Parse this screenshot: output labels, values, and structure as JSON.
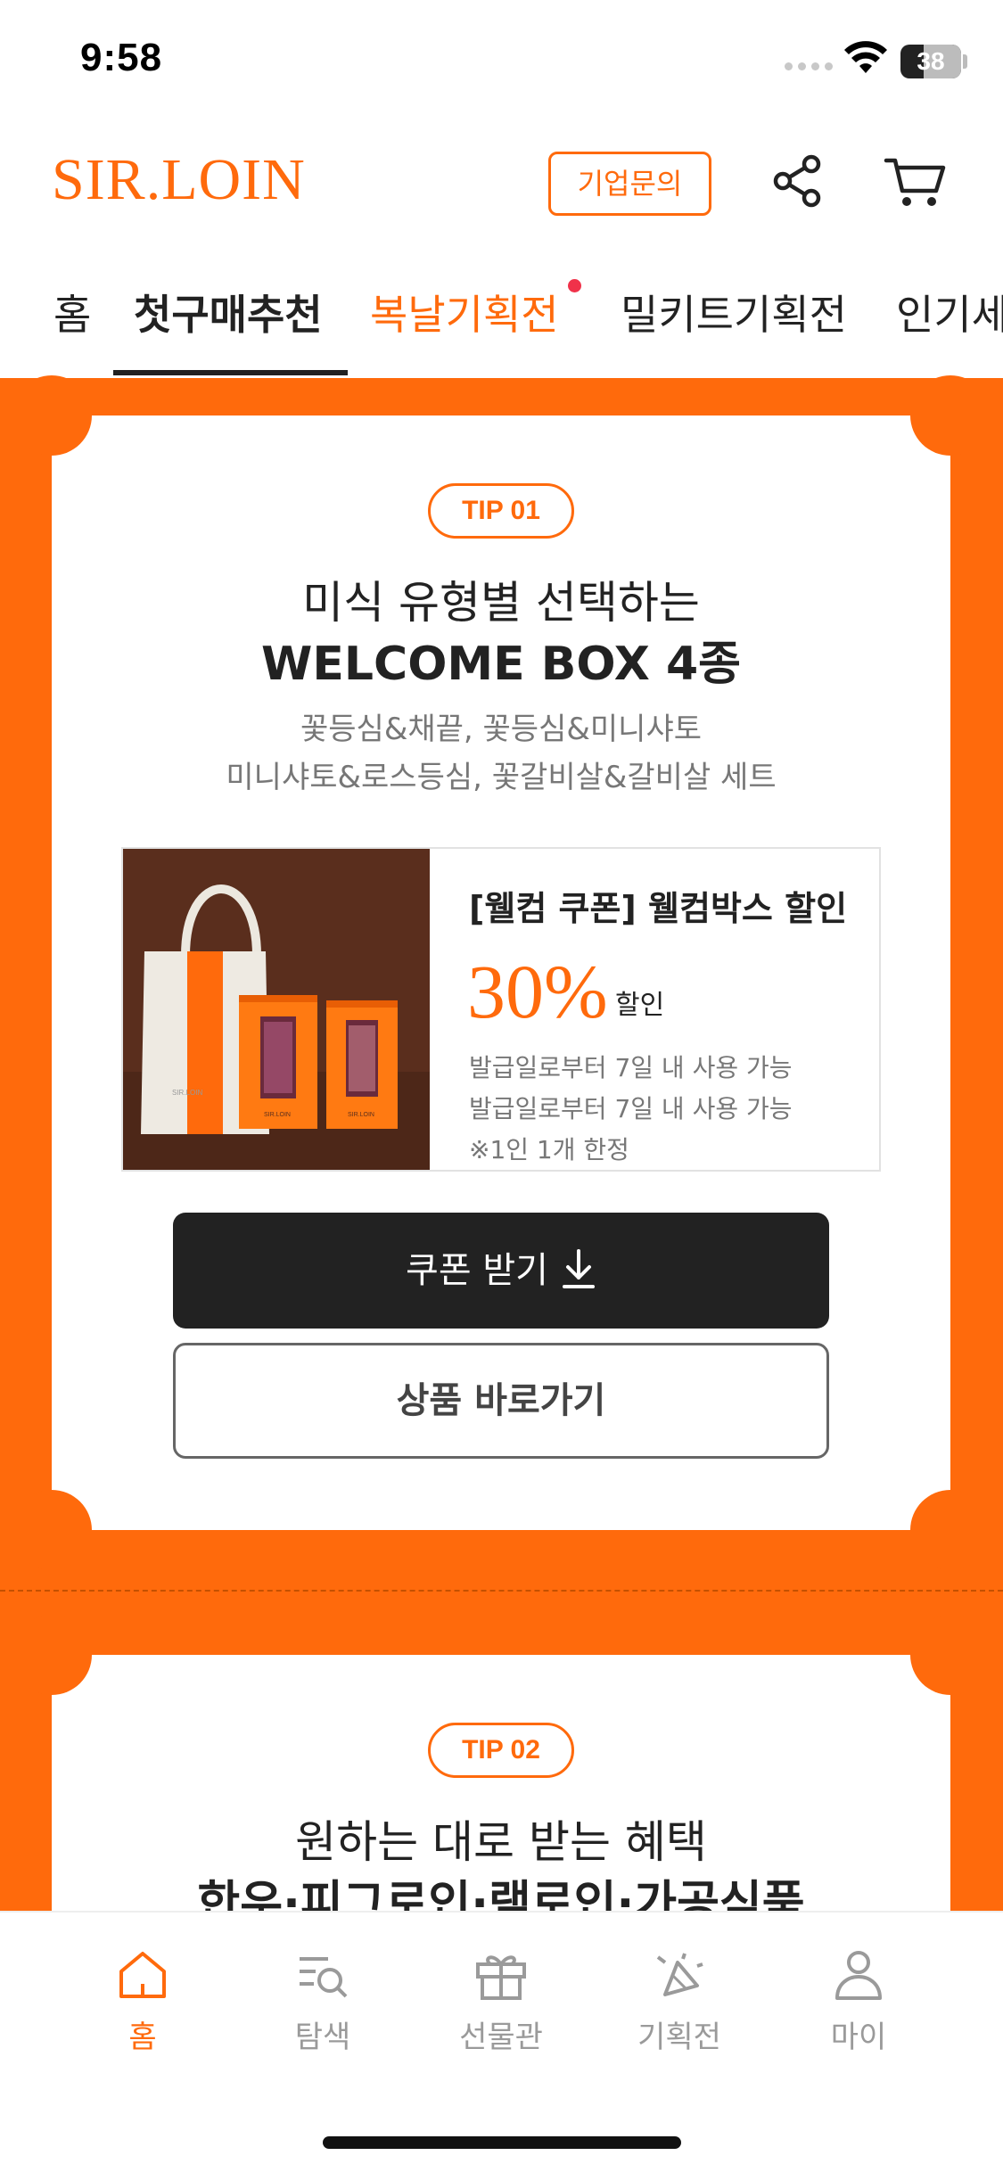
{
  "status_bar": {
    "time": "9:58",
    "battery": "38",
    "battery_level_percent": 38
  },
  "header": {
    "logo": "SIR.LOIN",
    "corp_inquiry_label": "기업문의",
    "share_icon": "share-icon",
    "cart_icon": "cart-icon",
    "brand_color": "#ff6a0c"
  },
  "tabs": [
    {
      "label": "홈",
      "active": false
    },
    {
      "label": "첫구매추천",
      "active": true
    },
    {
      "label": "복날기획전",
      "active": false,
      "highlight": true,
      "new_dot": true
    },
    {
      "label": "밀키트기획전",
      "active": false
    },
    {
      "label": "인기세",
      "active": false
    }
  ],
  "tip1": {
    "badge": "TIP 01",
    "title_line1": "미식 유형별 선택하는",
    "title_line2": "WELCOME BOX 4종",
    "sub_line1": "꽃등심&채끝, 꽃등심&미니샤토",
    "sub_line2": "미니샤토&로스등심, 꽃갈비살&갈비살 세트",
    "coupon": {
      "title": "[웰컴 쿠폰] 웰컴박스 할인",
      "percent": "30%",
      "percent_label": "할인",
      "line1": "발급일로부터 7일 내 사용 가능",
      "line2": "발급일로부터 7일 내 사용 가능",
      "line3": "※1인 1개 한정",
      "package_text_1": "SIR.LOIN",
      "package_text_2": "SIR.LOIN",
      "bag_text": "SIR.LOIN"
    },
    "download_button": "쿠폰 받기",
    "product_button": "상품 바로가기"
  },
  "tip2": {
    "badge": "TIP 02",
    "title_line1": "원하는 대로 받는 혜택",
    "title_line2": "한우·피그로인·램로인·가공식품"
  },
  "bottom_nav": [
    {
      "label": "홈",
      "icon": "home-icon",
      "active": true
    },
    {
      "label": "탐색",
      "icon": "search-list-icon",
      "active": false
    },
    {
      "label": "선물관",
      "icon": "gift-icon",
      "active": false
    },
    {
      "label": "기획전",
      "icon": "party-icon",
      "active": false
    },
    {
      "label": "마이",
      "icon": "person-icon",
      "active": false
    }
  ]
}
